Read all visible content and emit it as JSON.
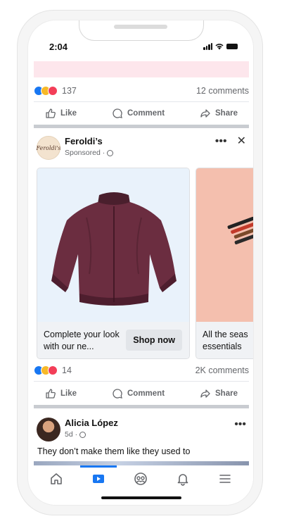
{
  "status_bar": {
    "time": "2:04"
  },
  "post1": {
    "reaction_count": "137",
    "comments": "12 comments"
  },
  "actions": {
    "like": "Like",
    "comment": "Comment",
    "share": "Share"
  },
  "ad": {
    "brand_name": "Feroldi’s",
    "brand_logo_text": "Feroldi's",
    "sponsored_label": "Sponsored ·",
    "cards": [
      {
        "text": "Complete your look with our ne...",
        "button": "Shop now"
      },
      {
        "text": "All the seas essentials"
      }
    ],
    "reaction_count": "14",
    "comments": "2K comments"
  },
  "post3": {
    "author": "Alicia López",
    "meta": "5d ·",
    "text": "They don’t make them like they used to"
  },
  "bottom_nav": {
    "items": [
      "home-icon",
      "video-icon",
      "groups-icon",
      "notifications-icon",
      "menu-icon"
    ],
    "active": "video-icon",
    "accent_color": "#1877f2"
  }
}
